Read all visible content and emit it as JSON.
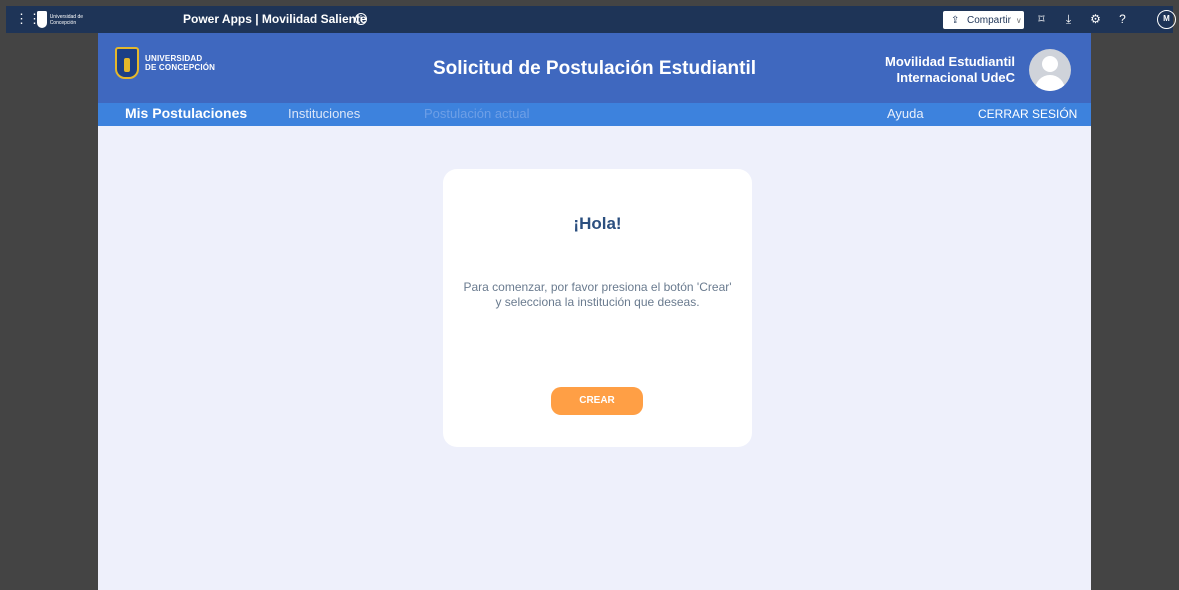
{
  "topbar": {
    "waffle_icon": "waffle-icon",
    "logo_text": "Universidad de Concepción",
    "app_title": "Power Apps | Movilidad Saliente",
    "info_icon": "ⓘ",
    "share_label": "Compartir",
    "share_icon": "share-icon",
    "icons": [
      "fit-screen-icon",
      "download-icon",
      "settings-icon",
      "help-icon"
    ],
    "user_initial": "M",
    "bar_color": "#1e3457"
  },
  "app": {
    "logo": {
      "line1": "UNIVERSIDAD",
      "line2": "DE CONCEPCIÓN"
    },
    "title": "Solicitud de Postulación Estudiantil",
    "header_right": {
      "line1": "Movilidad Estudiantil",
      "line2": "Internacional UdeC"
    },
    "nav": {
      "mis_postulaciones": "Mis Postulaciones",
      "instituciones": "Instituciones",
      "postulacion_actual": "Postulación actual",
      "ayuda": "Ayuda",
      "cerrar_sesion": "CERRAR SESIÓN"
    },
    "card": {
      "title": "¡Hola!",
      "message": "Para comenzar, por favor presiona el botón 'Crear' y selecciona la institución que deseas.",
      "button": "CREAR"
    },
    "colors": {
      "header": "#3f68bf",
      "nav": "#3d82dd",
      "background": "#eef0fb",
      "button": "#ff9f45"
    }
  }
}
